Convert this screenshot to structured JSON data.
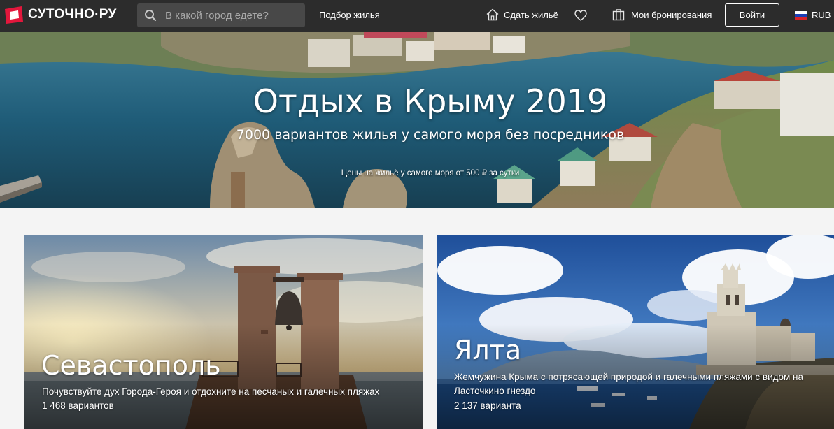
{
  "header": {
    "logo_text": "СУТОЧНО·РУ",
    "search_placeholder": "В какой город едете?",
    "nav_pick": "Подбор жилья",
    "nav_host": "Сдать жильё",
    "nav_bookings": "Мои бронирования",
    "login": "Войти",
    "currency": "RUB",
    "icons": {
      "logo": "logo-mark-icon",
      "search": "search-icon",
      "host": "house-icon",
      "favorites": "heart-icon",
      "bookings": "suitcase-icon",
      "flag": "russia-flag-icon"
    }
  },
  "hero": {
    "title": "Отдых в Крыму 2019",
    "subtitle": "7000 вариантов жилья у самого моря без посредников",
    "note": "Цены на жильё у самого моря от 500 ₽ за сутки"
  },
  "cards": [
    {
      "title": "Севастополь",
      "description": "Почувствуйте дух Города-Героя и отдохните на песчаных и галечных пляжах",
      "count": "1 468 вариантов"
    },
    {
      "title": "Ялта",
      "description": "Жемчужина Крыма с потрясающей природой и галечными пляжами с видом на Ласточкино гнездо",
      "count": "2 137 варианта"
    }
  ],
  "colors": {
    "header_bg": "#2c2c2c",
    "brand_red": "#e3173c",
    "page_bg": "#f4f4f4"
  }
}
